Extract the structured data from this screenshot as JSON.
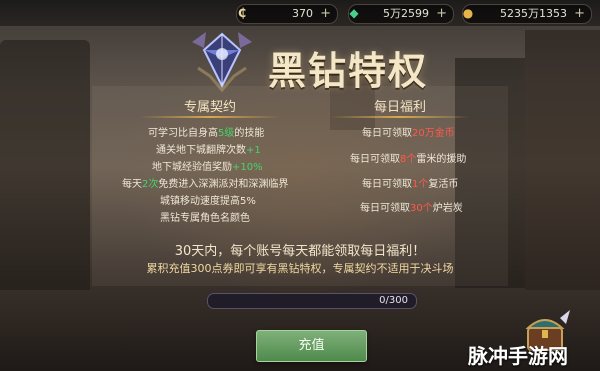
{
  "resources": {
    "currency1": {
      "amount": "370",
      "icon": "c-coin-icon"
    },
    "currency2": {
      "amount": "5万2599",
      "icon": "emerald-icon"
    },
    "currency3": {
      "amount": "5235万1353",
      "icon": "gold-coin-icon"
    },
    "plus": "+"
  },
  "title": "黑钻特权",
  "exclusive": {
    "heading": "专属契约",
    "lines": [
      [
        "可学习比自身高",
        "5级",
        "的技能"
      ],
      [
        "通关地下城翻牌次数",
        "+1",
        ""
      ],
      [
        "地下城经验值奖励",
        "+10%",
        ""
      ],
      [
        "每天",
        "2次",
        "免费进入深渊派对和深渊临界"
      ],
      [
        "城镇移动速度提高5%",
        "",
        ""
      ],
      [
        "黑钻专属角色名颜色",
        "",
        ""
      ]
    ]
  },
  "daily": {
    "heading": "每日福利",
    "lines": [
      [
        "每日可领取",
        "20万金币",
        ""
      ],
      [
        "每日可领取",
        "8个",
        "雷米的援助"
      ],
      [
        "每日可领取",
        "1个",
        "复活币"
      ],
      [
        "每日可领取",
        "30个",
        "炉岩炭"
      ]
    ]
  },
  "notice1": "30天内，每个账号每天都能领取每日福利！",
  "notice2": "累积充值300点券即可享有黑钻特权，专属契约不适用于决斗场",
  "progress": {
    "current": 0,
    "max": 300,
    "label": "0/300"
  },
  "button": {
    "recharge": "充值"
  },
  "watermark": "脉冲手游网",
  "colors": {
    "highlight_green": "#46d46a",
    "highlight_red": "#ff5a4a",
    "button_green": "#4f8a4c"
  }
}
